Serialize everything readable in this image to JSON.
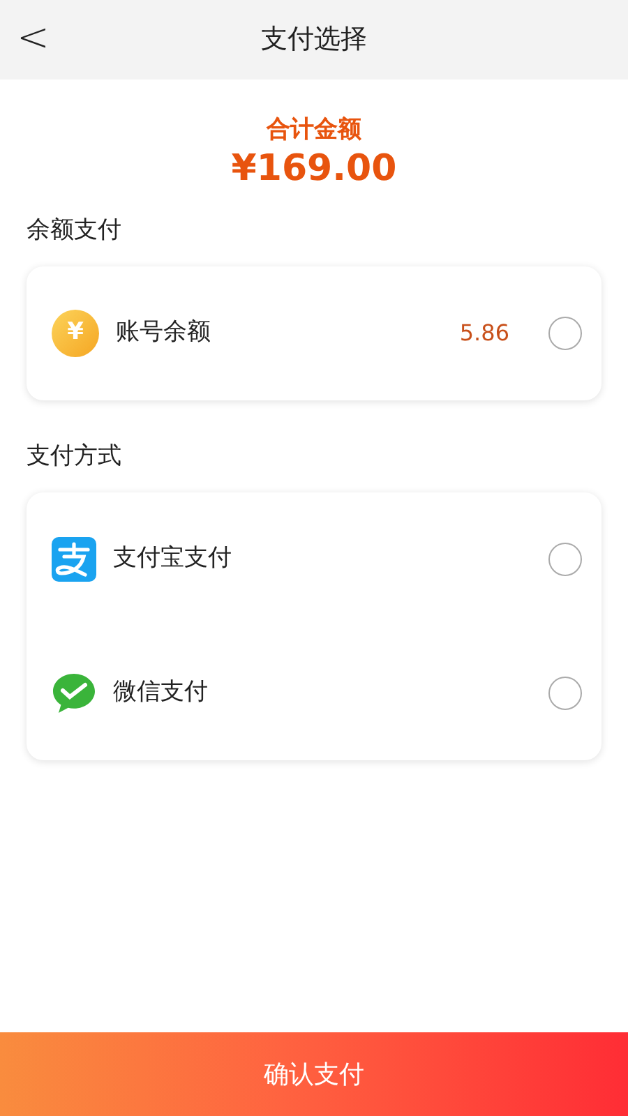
{
  "header": {
    "back": "<",
    "title": "支付选择"
  },
  "total": {
    "label": "合计金额",
    "amount": "¥169.00"
  },
  "sections": [
    {
      "title": "余额支付",
      "options": [
        {
          "kind": "coin",
          "symbol": "¥",
          "label": "账号余额",
          "value": "5.86",
          "selected": false
        }
      ]
    },
    {
      "title": "支付方式",
      "options": [
        {
          "kind": "alipay",
          "label": "支付宝支付",
          "selected": false
        },
        {
          "kind": "wechat",
          "label": "微信支付",
          "selected": false
        }
      ]
    }
  ],
  "confirm_button": "确认支付"
}
